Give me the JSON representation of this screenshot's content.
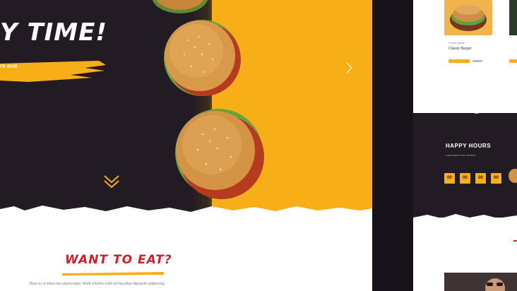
{
  "hero": {
    "headline": "Y TIME!",
    "brush_text": "rs and"
  },
  "section": {
    "title": "WANT TO EAT?",
    "paragraph": "Nunc in ut tellus nec ullamcorper. Morbi lobortis nulla vel faucibus dignissim adipiscing."
  },
  "right_panel": {
    "card_label": "Lorem ipsum",
    "card_title": "Classic Burger",
    "happy_hours_title": "HAPPY HOURS",
    "happy_sub": "Lorem ipsum dolor sit amet",
    "countdown": [
      "00",
      "00",
      "00",
      "00"
    ]
  },
  "colors": {
    "accent_yellow": "#f7ae17",
    "accent_red": "#d0202a",
    "dark_bg": "#231b24"
  },
  "icons": {
    "next": "chevron-right-icon",
    "scroll": "double-chevron-down-icon"
  }
}
